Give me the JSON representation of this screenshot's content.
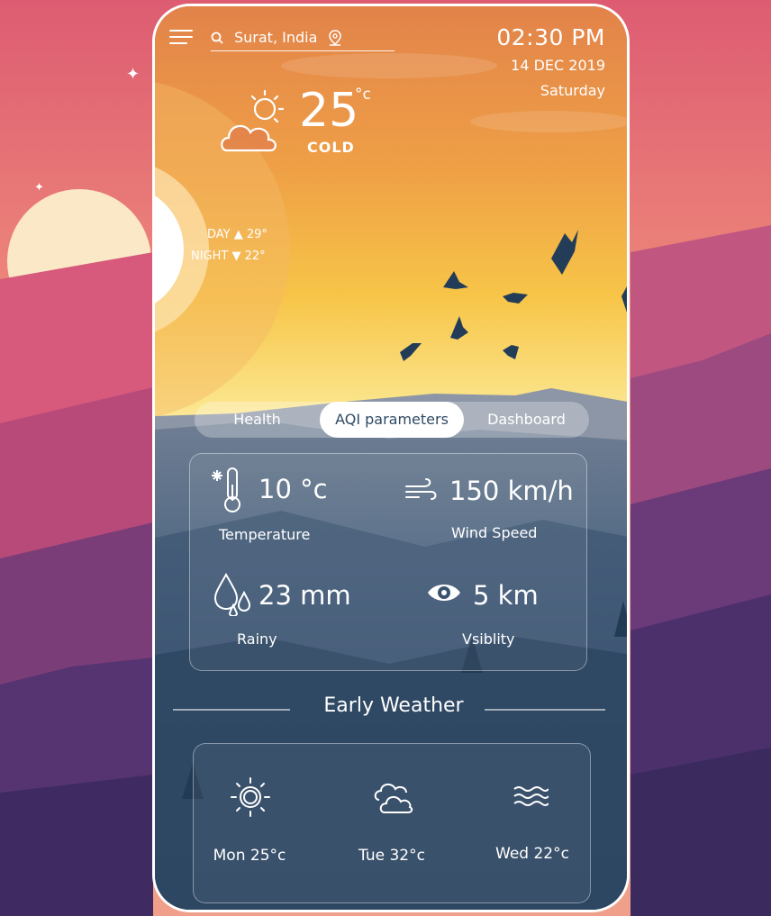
{
  "header": {
    "search": {
      "location": "Surat, India"
    },
    "time": "02:30 PM",
    "date": "14 DEC 2019",
    "day": "Saturday"
  },
  "current": {
    "temperature": "25",
    "unit": "°c",
    "condition": "COLD",
    "day_high": "DAY ▲ 29°",
    "night_low": "NIGHT ▼ 22°"
  },
  "tabs": [
    {
      "label": "Health",
      "active": false
    },
    {
      "label": "AQI parameters",
      "active": true
    },
    {
      "label": "Dashboard",
      "active": false
    }
  ],
  "stats": {
    "temperature": {
      "value": "10 °c",
      "label": "Temperature",
      "icon": "thermometer-snow-icon"
    },
    "wind": {
      "value": "150 km/h",
      "label": "Wind Speed",
      "icon": "wind-icon"
    },
    "rain": {
      "value": "23 mm",
      "label": "Rainy",
      "icon": "raindrops-icon"
    },
    "visibility": {
      "value": "5 km",
      "label": "Vsiblity",
      "icon": "eye-icon"
    }
  },
  "early_weather": {
    "title": "Early Weather",
    "days": [
      {
        "label": "Mon  25°c",
        "icon": "sun-icon"
      },
      {
        "label": "Tue  32°c",
        "icon": "clouds-icon"
      },
      {
        "label": "Wed  22°c",
        "icon": "waves-icon"
      }
    ]
  },
  "colors": {
    "sky_top": "#e9874a",
    "sky_mid": "#f7c04a",
    "sky_low": "#fbe788",
    "mountain_dark": "#233d58",
    "background_pink": "#d7607c"
  }
}
